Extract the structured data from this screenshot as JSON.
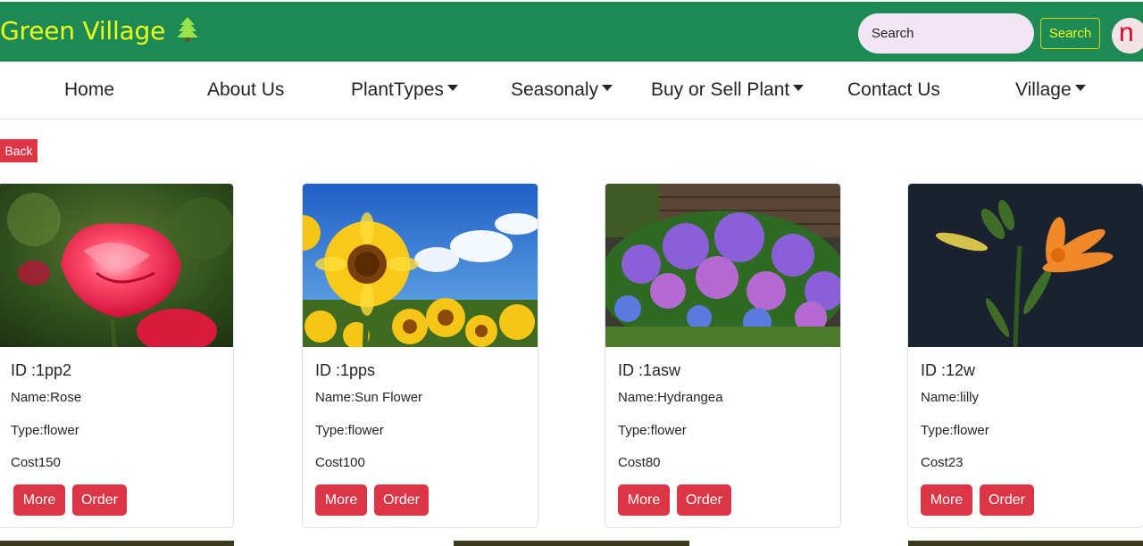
{
  "brand": {
    "name": "Green Village",
    "icon": "tree-icon",
    "color": "#ecff1a"
  },
  "header": {
    "background": "#1d8a55"
  },
  "search": {
    "placeholder": "Search",
    "button_label": "Search"
  },
  "user": {
    "avatar_initial": "n"
  },
  "nav": {
    "items": [
      {
        "label": "Home",
        "dropdown": false
      },
      {
        "label": "About Us",
        "dropdown": false
      },
      {
        "label": "PlantTypes",
        "dropdown": true
      },
      {
        "label": "Seasonaly",
        "dropdown": true
      },
      {
        "label": "Buy or Sell Plant",
        "dropdown": true
      },
      {
        "label": "Contact Us",
        "dropdown": false
      },
      {
        "label": "Village",
        "dropdown": true
      }
    ]
  },
  "back_label": "Back",
  "accent": "#dc3545",
  "plants": [
    {
      "id": "ID :1pp2",
      "name": "Name:Rose",
      "type": "Type:flower",
      "cost": "Cost150",
      "more": "More",
      "order": "Order"
    },
    {
      "id": "ID :1pps",
      "name": "Name:Sun Flower",
      "type": "Type:flower",
      "cost": "Cost100",
      "more": "More",
      "order": "Order"
    },
    {
      "id": "ID :1asw",
      "name": "Name:Hydrangea",
      "type": "Type:flower",
      "cost": "Cost80",
      "more": "More",
      "order": "Order"
    },
    {
      "id": "ID :12w",
      "name": "Name:lilly",
      "type": "Type:flower",
      "cost": "Cost23",
      "more": "More",
      "order": "Order"
    }
  ]
}
